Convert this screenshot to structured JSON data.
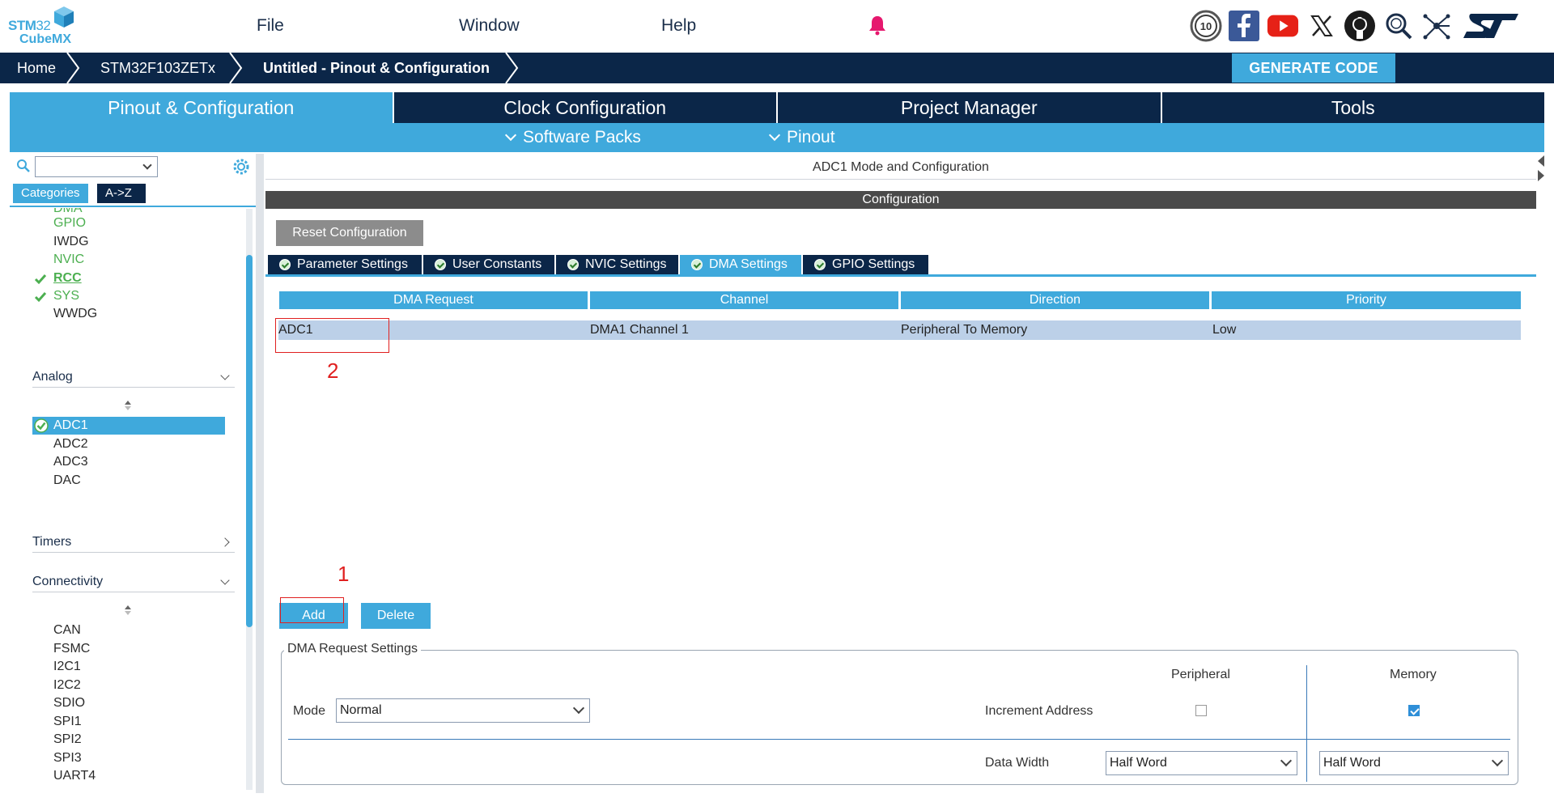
{
  "logo": {
    "line1_a": "STM",
    "line1_b": "32",
    "line2": "CubeMX"
  },
  "menu": {
    "file": "File",
    "window": "Window",
    "help": "Help"
  },
  "breadcrumb": {
    "home": "Home",
    "device": "STM32F103ZETx",
    "current": "Untitled - Pinout & Configuration"
  },
  "generate_label": "GENERATE CODE",
  "main_tabs": [
    "Pinout & Configuration",
    "Clock Configuration",
    "Project Manager",
    "Tools"
  ],
  "sub_menu": {
    "software_packs": "Software Packs",
    "pinout": "Pinout"
  },
  "left": {
    "tab_categories": "Categories",
    "tab_az": "A->Z",
    "system_items": [
      "DMA",
      "GPIO",
      "IWDG",
      "NVIC",
      "RCC",
      "SYS",
      "WWDG"
    ],
    "analog_label": "Analog",
    "analog_items": [
      "ADC1",
      "ADC2",
      "ADC3",
      "DAC"
    ],
    "timers_label": "Timers",
    "connectivity_label": "Connectivity",
    "connectivity_items": [
      "CAN",
      "FSMC",
      "I2C1",
      "I2C2",
      "SDIO",
      "SPI1",
      "SPI2",
      "SPI3",
      "UART4"
    ]
  },
  "panel": {
    "title": "ADC1 Mode and Configuration",
    "config_label": "Configuration",
    "reset_label": "Reset Configuration",
    "tabs": [
      "Parameter Settings",
      "User Constants",
      "NVIC Settings",
      "DMA Settings",
      "GPIO Settings"
    ]
  },
  "dma_table": {
    "headers": [
      "DMA Request",
      "Channel",
      "Direction",
      "Priority"
    ],
    "row": [
      "ADC1",
      "DMA1 Channel 1",
      "Peripheral To Memory",
      "Low"
    ]
  },
  "annotations": {
    "n1": "1",
    "n2": "2"
  },
  "buttons": {
    "add": "Add",
    "delete": "Delete"
  },
  "dma_settings": {
    "legend": "DMA Request Settings",
    "mode_label": "Mode",
    "mode_value": "Normal",
    "peripheral_label": "Peripheral",
    "memory_label": "Memory",
    "increment_label": "Increment Address",
    "data_width_label": "Data Width",
    "peripheral_width": "Half Word",
    "memory_width": "Half Word",
    "peripheral_increment": false,
    "memory_increment": true
  },
  "colors": {
    "accent": "#3fa9dc",
    "navy": "#0b2648",
    "green": "#4caf50",
    "red": "#e02020"
  }
}
